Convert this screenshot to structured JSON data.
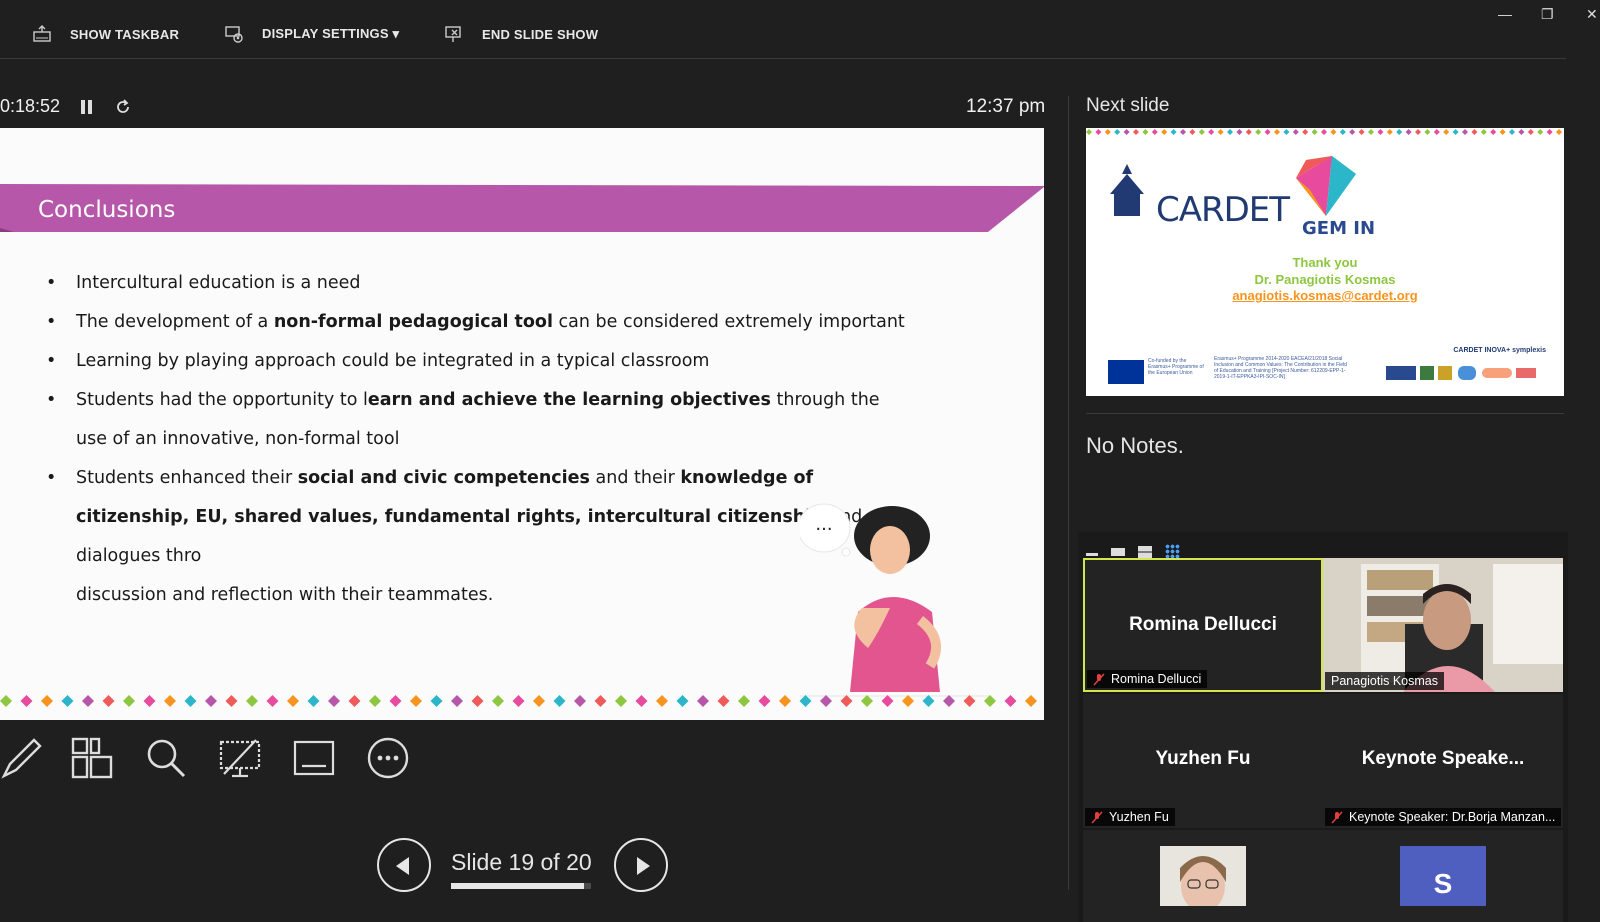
{
  "toolbar": {
    "show_taskbar": "SHOW TASKBAR",
    "display_settings": "DISPLAY SETTINGS ▾",
    "end_slide_show": "END SLIDE SHOW"
  },
  "presenter": {
    "elapsed": "0:18:52",
    "clock": "12:37 pm",
    "slide_counter": "Slide 19 of 20",
    "progress": 0.95
  },
  "slide": {
    "title": "Conclusions",
    "bullets": [
      {
        "parts": [
          "Intercultural education is a need"
        ]
      },
      {
        "parts": [
          "The development of a ",
          "non-formal pedagogical tool",
          " can be considered extremely important"
        ]
      },
      {
        "parts": [
          "Learning by playing approach could be integrated in a typical classroom"
        ]
      },
      {
        "parts": [
          "Students had the opportunity to l",
          "earn and achieve the learning objectives",
          " through the use of an innovative, non-formal tool"
        ]
      },
      {
        "parts": [
          "Students enhanced their ",
          "social and civic competencies",
          " and their ",
          "knowledge of citizenship, EU, shared values, fundamental rights, intercultural citizenship",
          " and dialogues thro",
          "discussion and reflection with their teammates."
        ]
      }
    ],
    "thought_bubble": "..."
  },
  "next_slide": {
    "label": "Next slide",
    "logo_cardet": "CARDET",
    "logo_gemin": "GEM IN",
    "thanks": "Thank you",
    "presenter": "Dr. Panagiotis Kosmas",
    "email": "anagiotis.kosmas@cardet.org",
    "cofunded": "Co-funded by the Erasmus+ Programme of the European Union",
    "programme": "Erasmus+ Programme 2014-2020 EACEA/21/2018 Social Inclusion and Common Values: The Contribution in the Field of Education and Training [Project Number: 612209-EPP-1-2019-1-IT-EPPKA3-IPI-SOC-IN]",
    "partners": "CARDET  INOVA+  symplexis"
  },
  "notes": {
    "text": "No Notes."
  },
  "participants": [
    {
      "display": "Romina Dellucci",
      "label": "Romina Dellucci",
      "muted": true,
      "active": true
    },
    {
      "display": "",
      "label": "Panagiotis Kosmas",
      "muted": false,
      "active": false,
      "video": true
    },
    {
      "display": "Yuzhen Fu",
      "label": "Yuzhen Fu",
      "muted": true,
      "active": false
    },
    {
      "display": "Keynote  Speake...",
      "label": "Keynote Speaker: Dr.Borja Manzan...",
      "muted": true,
      "active": false
    },
    {
      "display": "",
      "label": "",
      "muted": false,
      "active": false,
      "thumb": "photo"
    },
    {
      "display": "S",
      "label": "",
      "muted": false,
      "active": false,
      "thumb": "initial"
    }
  ],
  "colors": {
    "banner": "#b657a9",
    "accent": "#d3e64a",
    "cardet_blue": "#213a73",
    "link_orange": "#f7941d",
    "thanks_green": "#8dc63f"
  },
  "icons": [
    "taskbar-icon",
    "display-settings-icon",
    "end-show-icon",
    "pause-icon",
    "reset-icon",
    "pen-icon",
    "all-slides-icon",
    "zoom-icon",
    "black-screen-icon",
    "subtitles-icon",
    "more-icon",
    "prev-icon",
    "next-icon",
    "mic-off-icon"
  ]
}
